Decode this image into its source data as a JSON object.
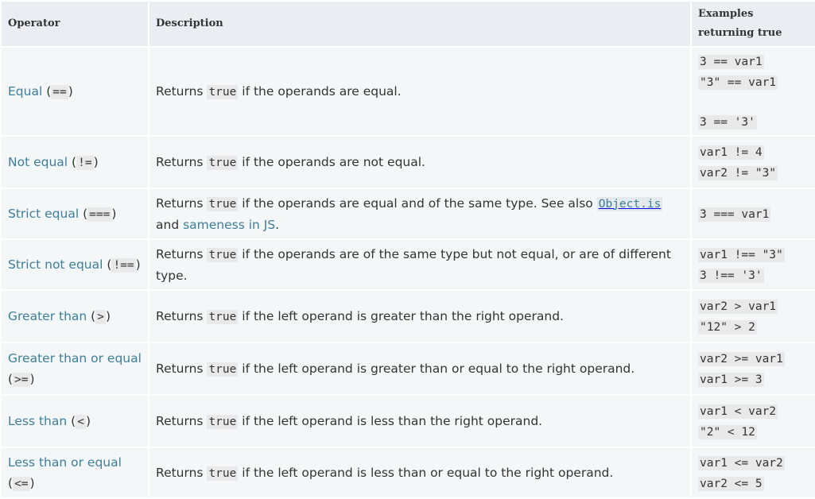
{
  "headers": {
    "operator": "Operator",
    "description": "Description",
    "examples": "Examples returning true"
  },
  "rows": [
    {
      "name": "Equal",
      "symbol": "==",
      "desc_before": "Returns ",
      "desc_code": "true",
      "desc_after": " if the operands are equal.",
      "examples": [
        "3 == var1",
        "\"3\" == var1",
        "",
        "3 == '3'"
      ]
    },
    {
      "name": "Not equal",
      "symbol": "!=",
      "desc_before": "Returns ",
      "desc_code": "true",
      "desc_after": " if the operands are not equal.",
      "examples": [
        "var1 != 4",
        "var2 != \"3\""
      ]
    },
    {
      "name": "Strict equal",
      "symbol": "===",
      "desc_before": "Returns ",
      "desc_code": "true",
      "desc_after": " if the operands are equal and of the same type. See also ",
      "desc_link_code": "Object.is",
      "desc_and": " and ",
      "desc_link": "sameness in JS",
      "desc_end": ".",
      "examples": [
        "3 === var1"
      ]
    },
    {
      "name": "Strict not equal",
      "symbol": "!==",
      "desc_before": "Returns ",
      "desc_code": "true",
      "desc_after": " if the operands are of the same type but not equal, or are of different type.",
      "examples": [
        "var1 !== \"3\"",
        "3 !== '3'"
      ]
    },
    {
      "name": "Greater than",
      "symbol": ">",
      "desc_before": "Returns ",
      "desc_code": "true",
      "desc_after": " if the left operand is greater than the right operand.",
      "examples": [
        "var2 > var1",
        "\"12\" > 2"
      ]
    },
    {
      "name": "Greater than or equal",
      "symbol": ">=",
      "desc_before": "Returns ",
      "desc_code": "true",
      "desc_after": " if the left operand is greater than or equal to the right operand.",
      "examples": [
        "var2 >= var1",
        "var1 >= 3"
      ]
    },
    {
      "name": "Less than",
      "symbol": "<",
      "desc_before": "Returns ",
      "desc_code": "true",
      "desc_after": " if the left operand is less than the right operand.",
      "examples": [
        "var1 < var2",
        "\"2\" < 12"
      ]
    },
    {
      "name": "Less than or equal",
      "symbol": "<=",
      "desc_before": "Returns ",
      "desc_code": "true",
      "desc_after": " if the left operand is less than or equal to the right operand.",
      "examples": [
        "var1 <= var2",
        "var2 <= 5"
      ]
    }
  ],
  "colors": {
    "link": "#3d7e9a",
    "header_bg": "#eaeef2",
    "row_bg": "#f4f7f8",
    "code_bg": "#e9e9e9"
  }
}
